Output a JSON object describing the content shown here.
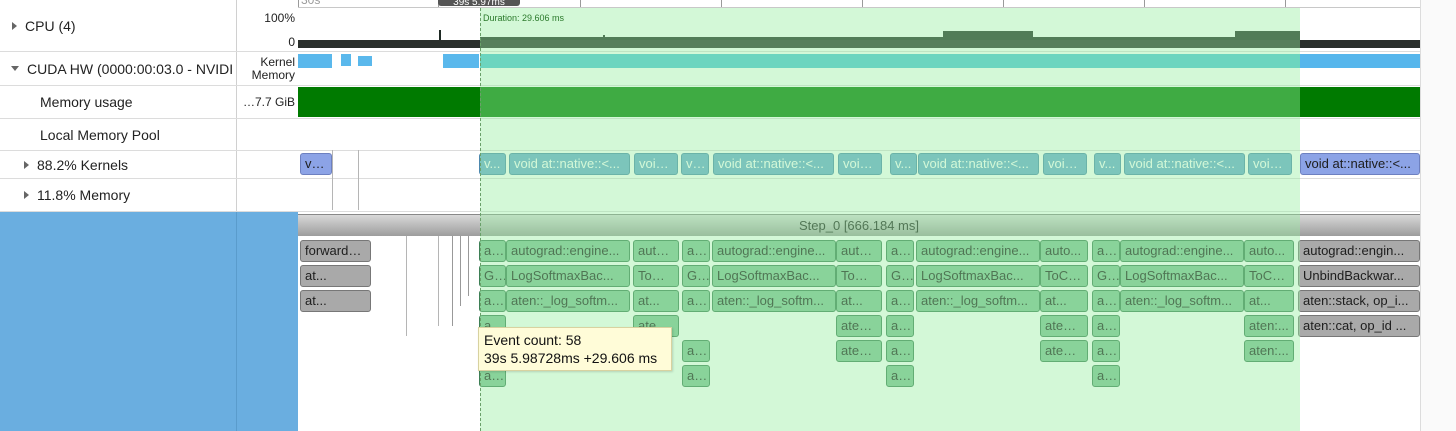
{
  "ruler": {
    "labels": [
      "30s",
      "5.97ms"
    ],
    "marker": "39s 5.97ms"
  },
  "tracks": {
    "cpu": {
      "name": "CPU (4)",
      "top": "100%",
      "bottom": "0"
    },
    "cuda": {
      "name": "CUDA HW (0000:00:03.0 - NVIDI",
      "sub1": "Kernel",
      "sub2": "Memory"
    },
    "memory_usage": {
      "name": "Memory usage",
      "value": "…7.7 GiB"
    },
    "local_pool": {
      "name": "Local Memory Pool"
    },
    "kernels": {
      "name": "88.2% Kernels"
    },
    "memory": {
      "name": "11.8% Memory"
    }
  },
  "selection": {
    "duration": "Duration: 29.606 ms"
  },
  "step": {
    "label": "Step_0 [666.184 ms]"
  },
  "kernels_row": [
    {
      "label": "voi...",
      "style": "blue2"
    },
    {
      "label": "v...",
      "style": "kblue"
    },
    {
      "label": "void at::native::<...",
      "style": "kblue"
    },
    {
      "label": "void ...",
      "style": "kblue"
    },
    {
      "label": "void ...",
      "style": "kblue"
    },
    {
      "label": "void at::native::<...",
      "style": "kblue"
    },
    {
      "label": "void ...",
      "style": "kblue"
    },
    {
      "label": "v...",
      "style": "kblue"
    },
    {
      "label": "void at::native::<...",
      "style": "kblue"
    },
    {
      "label": "void ...",
      "style": "kblue"
    },
    {
      "label": "v...",
      "style": "kblue"
    },
    {
      "label": "void at::native::<...",
      "style": "kblue"
    },
    {
      "label": "void ...",
      "style": "kblue"
    },
    {
      "label": "void at::native::<...",
      "style": "blue2"
    }
  ],
  "row1": [
    "forward_...",
    "a...",
    "autograd::engine...",
    "auto...",
    "a...",
    "autograd::engine...",
    "auto...",
    "a...",
    "autograd::engine...",
    "auto...",
    "a...",
    "autograd::engine...",
    "auto...",
    "autograd::engin..."
  ],
  "row2": [
    "at...",
    "G...",
    "LogSoftmaxBac...",
    "ToCo...",
    "G...",
    "LogSoftmaxBac...",
    "ToCo...",
    "G...",
    "LogSoftmaxBac...",
    "ToCo...",
    "G...",
    "LogSoftmaxBac...",
    "ToCo...",
    "UnbindBackwar..."
  ],
  "row3": [
    "at...",
    "at...",
    "aten::_log_softm...",
    "at...",
    "at...",
    "aten::_log_softm...",
    "at...",
    "at...",
    "aten::_log_softm...",
    "at...",
    "at...",
    "aten::_log_softm...",
    "at...",
    "aten::stack, op_i..."
  ],
  "row4": [
    "at...",
    "aten:...",
    "aten:...",
    "at...",
    "aten:...",
    "at...",
    "aten:...",
    "aten::cat, op_id ..."
  ],
  "row5": [
    "at...",
    "at...",
    "aten:...",
    "at...",
    "aten:...",
    "at...",
    "aten:..."
  ],
  "row6": [
    "at...",
    "at...",
    "at...",
    "at..."
  ],
  "tooltip": {
    "line1": "Event count: 58",
    "line2": "39s 5.98728ms +29.606 ms"
  },
  "colors": {
    "selection": "#96eea0",
    "memory_usage": "#007a00",
    "kernel_bar": "#4fc3d6",
    "slice": "#80c097",
    "left_blue": "#6aaee0"
  }
}
